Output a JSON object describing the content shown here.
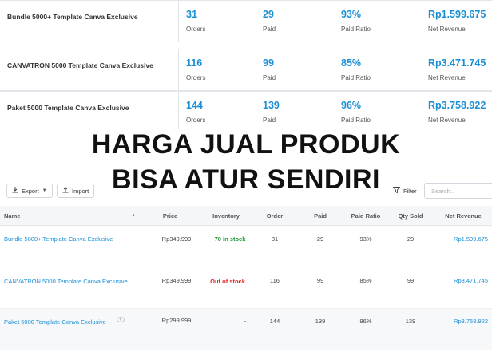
{
  "summary": [
    {
      "name": "Bundle 5000+ Template Canva Exclusive",
      "orders": "31",
      "orders_label": "Orders",
      "paid": "29",
      "paid_label": "Paid",
      "ratio": "93%",
      "ratio_label": "Paid Ratio",
      "revenue": "Rp1.599.675",
      "revenue_label": "Net Revenue"
    },
    {
      "name": "CANVATRON 5000 Template Canva Exclusive",
      "orders": "116",
      "orders_label": "Orders",
      "paid": "99",
      "paid_label": "Paid",
      "ratio": "85%",
      "ratio_label": "Paid Ratio",
      "revenue": "Rp3.471.745",
      "revenue_label": "Net Revenue"
    },
    {
      "name": "Paket 5000 Template Canva Exclusive",
      "orders": "144",
      "orders_label": "Orders",
      "paid": "139",
      "paid_label": "Paid",
      "ratio": "96%",
      "ratio_label": "Paid Ratio",
      "revenue": "Rp3.758.922",
      "revenue_label": "Net Revenue"
    }
  ],
  "banner": {
    "line1": "HARGA JUAL PRODUK",
    "line2": "BISA ATUR SENDIRI"
  },
  "toolbar": {
    "export_label": "Export",
    "import_label": "Import",
    "filter_label": "Filter",
    "search_placeholder": "Search.."
  },
  "table": {
    "headers": {
      "name": "Name",
      "price": "Price",
      "inventory": "Inventory",
      "order": "Order",
      "paid": "Paid",
      "ratio": "Paid Ratio",
      "qty": "Qty Sold",
      "revenue": "Net Revenue"
    },
    "rows": [
      {
        "name": "Bundle 5000+ Template Canva Exclusive",
        "price": "Rp349.999",
        "inventory": "70 in stock",
        "order": "31",
        "paid": "29",
        "ratio": "93%",
        "qty": "29",
        "revenue": "Rp1.599.675"
      },
      {
        "name": "CANVATRON 5000 Template Canva Exclusive",
        "price": "Rp349.999",
        "inventory": "Out of stock",
        "order": "116",
        "paid": "99",
        "ratio": "85%",
        "qty": "99",
        "revenue": "Rp3.471.745"
      },
      {
        "name": "Paket 5000 Template Canva Exclusive",
        "price": "Rp299.999",
        "inventory": "-",
        "order": "144",
        "paid": "139",
        "ratio": "96%",
        "qty": "139",
        "revenue": "Rp3.758.922"
      }
    ]
  },
  "colors": {
    "accent": "#1a8fd6",
    "in_stock": "#1e9b3c",
    "out_of_stock": "#e02424"
  }
}
